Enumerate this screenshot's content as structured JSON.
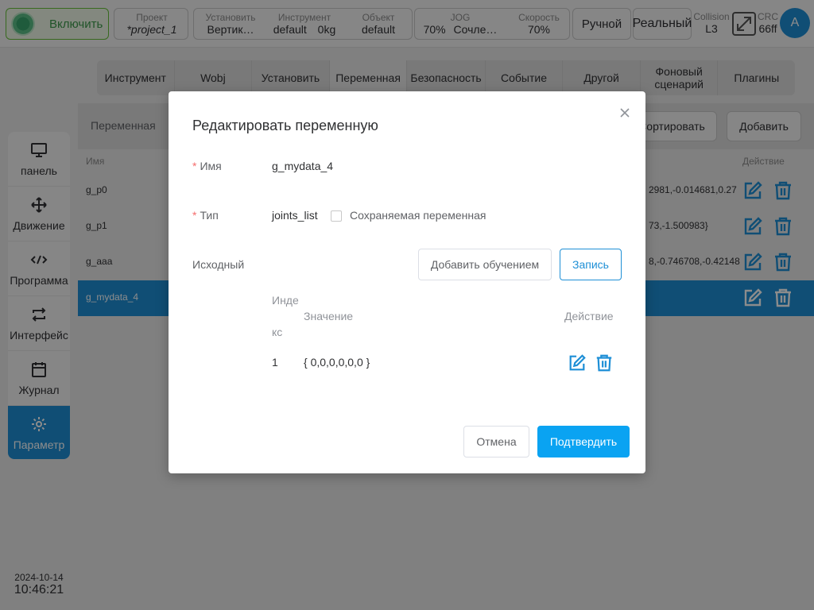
{
  "topbar": {
    "enable_label": "Включить",
    "project": {
      "key": "Проект",
      "value": "*project_1"
    },
    "install": {
      "key": "Установить",
      "value": "Вертик…"
    },
    "tool": {
      "key": "Инструмент",
      "value": "default",
      "extra": "0kg"
    },
    "object": {
      "key": "Объект",
      "value": "default"
    },
    "jog": {
      "key": "JOG",
      "value": "70%",
      "extra": "Сочле…"
    },
    "speed": {
      "key": "Скорость",
      "value": "70%"
    },
    "manual_label": "Ручной",
    "real_label": "Реальный",
    "collision": {
      "key": "Collision",
      "value": "L3"
    },
    "crc": {
      "key": "CRC",
      "value": "66ff"
    },
    "avatar_letter": "A"
  },
  "sidebar": {
    "items": [
      {
        "label": "панель",
        "icon": "monitor-icon"
      },
      {
        "label": "Движение",
        "icon": "move-icon"
      },
      {
        "label": "Программа",
        "icon": "code-icon"
      },
      {
        "label": "Интерфейс",
        "icon": "interface-icon"
      },
      {
        "label": "Журнал",
        "icon": "calendar-icon"
      },
      {
        "label": "Параметр",
        "icon": "gear-icon"
      }
    ],
    "date": "2024-10-14",
    "time": "10:46:21"
  },
  "tabs": [
    "Инструмент",
    "Wobj",
    "Установить",
    "Переменная",
    "Безопасность",
    "Событие",
    "Другой",
    "Фоновый сценарий",
    "Плагины"
  ],
  "subbar": {
    "title": "Переменная",
    "sort_label": "Сортировать",
    "add_label": "Добавить"
  },
  "table": {
    "col_name": "Имя",
    "col_action": "Действие",
    "rows": [
      {
        "name": "g_p0",
        "value": "2981,-0.014681,0.27"
      },
      {
        "name": "g_p1",
        "value": "73,-1.500983}"
      },
      {
        "name": "g_aaa",
        "value": "8,-0.746708,-0.42148"
      },
      {
        "name": "g_mydata_4",
        "value": ""
      }
    ]
  },
  "dialog": {
    "title": "Редактировать переменную",
    "required_mark": "*",
    "name_label": "Имя",
    "name_value": "g_mydata_4",
    "type_label": "Тип",
    "type_value": "joints_list",
    "persist_label": "Сохраняемая переменная",
    "initial_label": "Исходный",
    "add_teach_label": "Добавить обучением",
    "record_label": "Запись",
    "sub_table": {
      "col_index_1": "Инде",
      "col_index_2": "кс",
      "col_value": "Значение",
      "col_action": "Действие",
      "rows": [
        {
          "index": "1",
          "value": "{ 0,0,0,0,0,0 }"
        }
      ]
    },
    "cancel_label": "Отмена",
    "confirm_label": "Подтвердить"
  },
  "colors": {
    "accent": "#1e8fd6",
    "primary_button": "#0aa3f2",
    "danger": "#f56c6c",
    "enable_green": "#3d9a4c"
  }
}
